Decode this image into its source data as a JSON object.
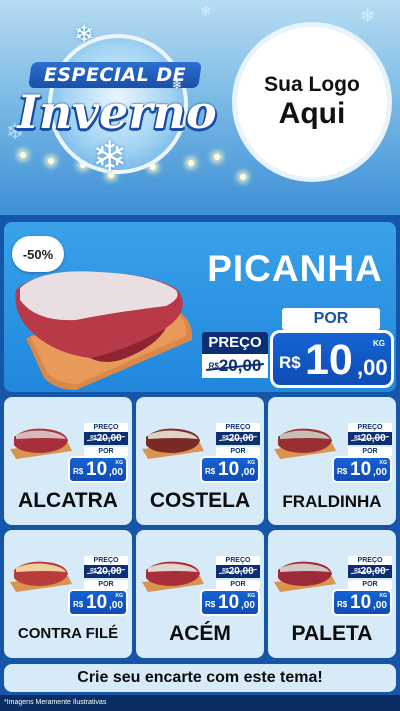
{
  "header": {
    "title_top": "ESPECIAL DE",
    "title_main": "Inverno",
    "logo_line1": "Sua Logo",
    "logo_line2": "Aqui"
  },
  "featured": {
    "discount": "-50%",
    "name": "PICANHA",
    "por_label": "POR",
    "preco_label": "PREÇO",
    "old_currency": "R$",
    "old_price": "20,00",
    "currency": "R$",
    "price_int": "10",
    "price_dec": ",00",
    "unit": "KG"
  },
  "price_labels": {
    "preco": "PREÇO",
    "por": "POR",
    "old_currency": "R$",
    "old_price": "20,00",
    "currency": "R$",
    "price_int": "10",
    "price_dec": ",00",
    "unit": "KG"
  },
  "products": [
    {
      "name": "ALCATRA"
    },
    {
      "name": "COSTELA"
    },
    {
      "name": "FRALDINHA"
    },
    {
      "name": "CONTRA FILÉ"
    },
    {
      "name": "ACÉM"
    },
    {
      "name": "PALETA"
    }
  ],
  "cta": "Crie seu encarte com este tema!",
  "footnote": "*Imagens Meramente Ilustrativas",
  "colors": {
    "brand_blue": "#1656a8",
    "price_box": "#1563d3",
    "dark_label": "#0c2f73",
    "card_bg": "#d6eaf8",
    "featured_bg": "#2187dc"
  }
}
